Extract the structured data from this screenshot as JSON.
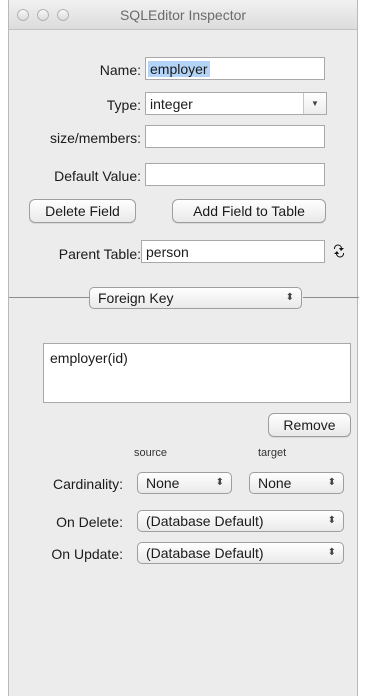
{
  "window": {
    "title": "SQLEditor Inspector"
  },
  "field_form": {
    "name_label": "Name:",
    "name_value": "employer",
    "type_label": "Type:",
    "type_value": "integer",
    "size_label": "size/members:",
    "size_value": "",
    "default_label": "Default Value:",
    "default_value": "",
    "delete_field_label": "Delete Field",
    "add_field_label": "Add Field to Table",
    "parent_table_label": "Parent Table:",
    "parent_table_value": "person"
  },
  "section": {
    "selected_option": "Foreign Key"
  },
  "foreign_key": {
    "list_items": [
      "employer(id)"
    ],
    "remove_label": "Remove",
    "source_header": "source",
    "target_header": "target",
    "cardinality_label": "Cardinality:",
    "cardinality_source": "None",
    "cardinality_target": "None",
    "on_delete_label": "On Delete:",
    "on_delete_value": "(Database Default)",
    "on_update_label": "On Update:",
    "on_update_value": "(Database Default)"
  }
}
